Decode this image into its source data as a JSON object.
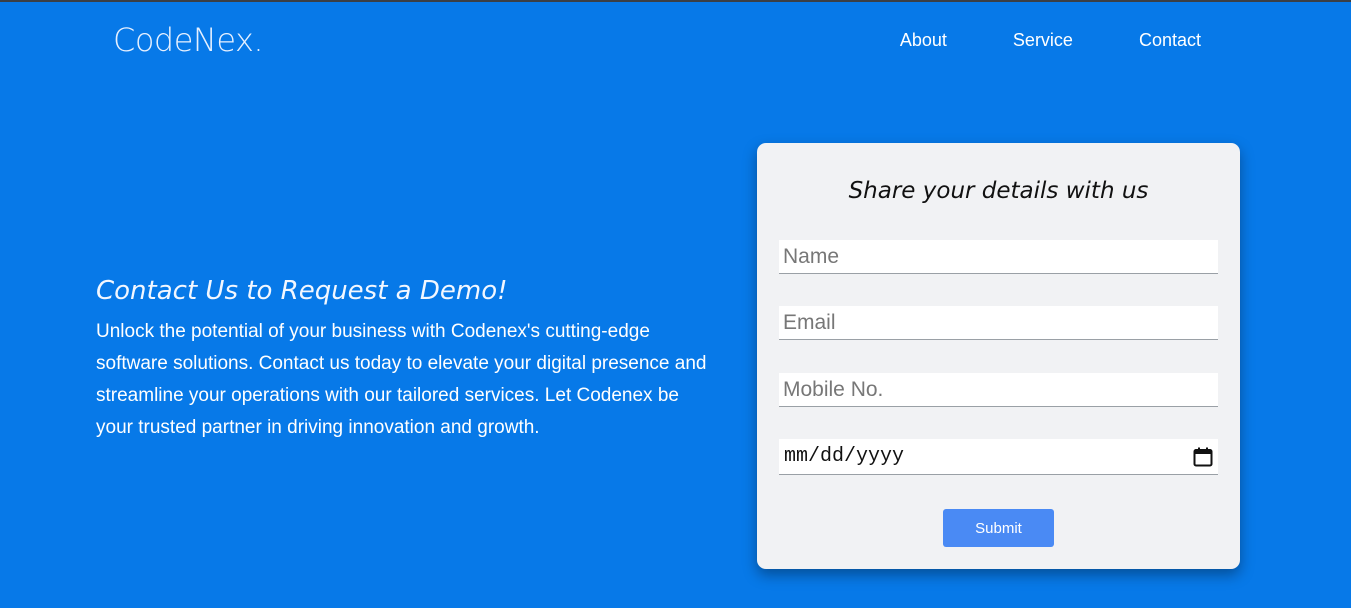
{
  "header": {
    "logo": "CodeNex.",
    "nav": [
      "About",
      "Service",
      "Contact"
    ]
  },
  "hero": {
    "heading": "Contact Us to Request a Demo!",
    "body": "Unlock the potential of your business with Codenex's cutting-edge software solutions. Contact us today to elevate your digital presence and streamline your operations with our tailored services. Let Codenex be your trusted partner in driving innovation and growth."
  },
  "form": {
    "title": "Share your details with us",
    "name_placeholder": "Name",
    "email_placeholder": "Email",
    "mobile_placeholder": "Mobile No.",
    "date_placeholder": "mm/dd/yyyy",
    "submit_label": "Submit"
  },
  "colors": {
    "background": "#0779e8",
    "card": "#f1f2f4",
    "button": "#4a8af4"
  }
}
